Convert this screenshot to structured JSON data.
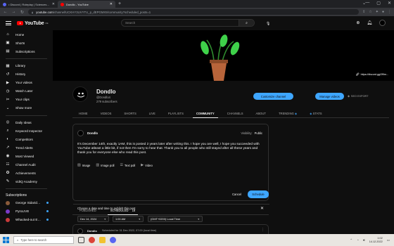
{
  "browser": {
    "tabs": [
      {
        "title": "• Discord | Roleplay | Sciences Of...",
        "icon": "discord-icon",
        "active": false
      },
      {
        "title": "Dondlo - YouTube",
        "icon": "youtube-icon",
        "active": true
      }
    ],
    "new_tab": "+",
    "url_host": "youtube.com",
    "url_path": "/channel/UCKHY3UVYTU_p_dEPGMX9/community?scheduled_posts=1"
  },
  "youtube": {
    "logo_text": "YouTube",
    "logo_sup": "DE",
    "search_placeholder": "Search"
  },
  "sidebar": {
    "top": [
      {
        "label": "Home",
        "icon": "home-icon",
        "glyph": "⌂"
      },
      {
        "label": "Shorts",
        "icon": "shorts-icon",
        "glyph": "▣"
      },
      {
        "label": "Subscriptions",
        "icon": "subscriptions-icon",
        "glyph": "▤"
      }
    ],
    "library": [
      {
        "label": "Library",
        "icon": "library-icon",
        "glyph": "▦"
      },
      {
        "label": "History",
        "icon": "history-icon",
        "glyph": "↺"
      },
      {
        "label": "Your videos",
        "icon": "your-videos-icon",
        "glyph": "▶"
      },
      {
        "label": "Watch Later",
        "icon": "watch-later-icon",
        "glyph": "◷"
      },
      {
        "label": "Your clips",
        "icon": "clips-icon",
        "glyph": "✂"
      },
      {
        "label": "Show more",
        "icon": "chevron-down-icon",
        "glyph": "⌄"
      }
    ],
    "tools": [
      {
        "label": "Daily Ideas",
        "icon": "daily-ideas-icon",
        "glyph": "◎"
      },
      {
        "label": "Keyword Inspector",
        "icon": "keyword-inspector-icon",
        "glyph": "⌕"
      },
      {
        "label": "Competitors",
        "icon": "competitors-icon",
        "glyph": "◐"
      },
      {
        "label": "Trend Alerts",
        "icon": "trend-alerts-icon",
        "glyph": "↗"
      },
      {
        "label": "Most Viewed",
        "icon": "most-viewed-icon",
        "glyph": "◉"
      },
      {
        "label": "Channel Audit",
        "icon": "channel-audit-icon",
        "glyph": "☷"
      },
      {
        "label": "Achievements",
        "icon": "achievements-icon",
        "glyph": "✪"
      },
      {
        "label": "vidIQ Academy",
        "icon": "academy-icon",
        "glyph": "✎"
      }
    ],
    "subscriptions_heading": "Subscriptions",
    "subscriptions": [
      {
        "label": "George Sidaridis ...",
        "color": "#8a5a3a"
      },
      {
        "label": "PyroLIVE",
        "color": "#7a3ac8"
      },
      {
        "label": "Whacked-out Ent...",
        "color": "#c83a3a"
      }
    ]
  },
  "channel": {
    "name": "Dondlo",
    "handle": "@Dondlo4",
    "subscribers": "279 subscribers",
    "customize_label": "Customize channel",
    "manage_label": "Manage videos",
    "seo_export": "SEO EXPORT",
    "banner_link": "https://discord.gg/2f9m...",
    "tabs": [
      {
        "label": "HOME",
        "active": false
      },
      {
        "label": "VIDEOS",
        "active": false
      },
      {
        "label": "SHORTS",
        "active": false
      },
      {
        "label": "LIVE",
        "active": false
      },
      {
        "label": "PLAYLISTS",
        "active": false
      },
      {
        "label": "COMMUNITY",
        "active": true
      },
      {
        "label": "CHANNELS",
        "active": false
      },
      {
        "label": "ABOUT",
        "active": false
      },
      {
        "label": "TRENDING",
        "active": false,
        "vi": false
      },
      {
        "label": "STATS",
        "active": false,
        "vi": false
      }
    ]
  },
  "composer": {
    "author": "Dondlo",
    "visibility_label": "Visibility:",
    "visibility_value": "Public",
    "text": "It's December 14th, exactly 1AM, this is posted 2 years later after writing this. I hope you are well, I hope you succeeded with YouTube atleast a little bit, if not then I'm sorry to hear that. Thank you to all people who still stayed after all these years and thank you for everyone else who read this post.",
    "tools": [
      {
        "label": "Image",
        "icon": "image-icon",
        "glyph": "▨"
      },
      {
        "label": "Image poll",
        "icon": "image-poll-icon",
        "glyph": "▥"
      },
      {
        "label": "Text poll",
        "icon": "text-poll-icon",
        "glyph": "☰"
      },
      {
        "label": "Video",
        "icon": "video-icon",
        "glyph": "▶"
      }
    ],
    "cancel_label": "Cancel",
    "schedule_label": "Schedule",
    "schedule_prompt": "Choose a date and time to publish this post",
    "date": "Dec 14, 2024",
    "time": "1:00 AM",
    "timezone": "(GMT+0200) Local Time"
  },
  "post_tabs": {
    "published": "PUBLISHED",
    "scheduled": "SCHEDULED",
    "scheduled_count": "18"
  },
  "scheduled_post": {
    "author": "Dondlo",
    "info": "Scheduled for 31 Dec 2022, 07:00 (local time)"
  },
  "taskbar": {
    "search_placeholder": "Type here to search",
    "time": "1:02",
    "date": "14.12.2022"
  }
}
